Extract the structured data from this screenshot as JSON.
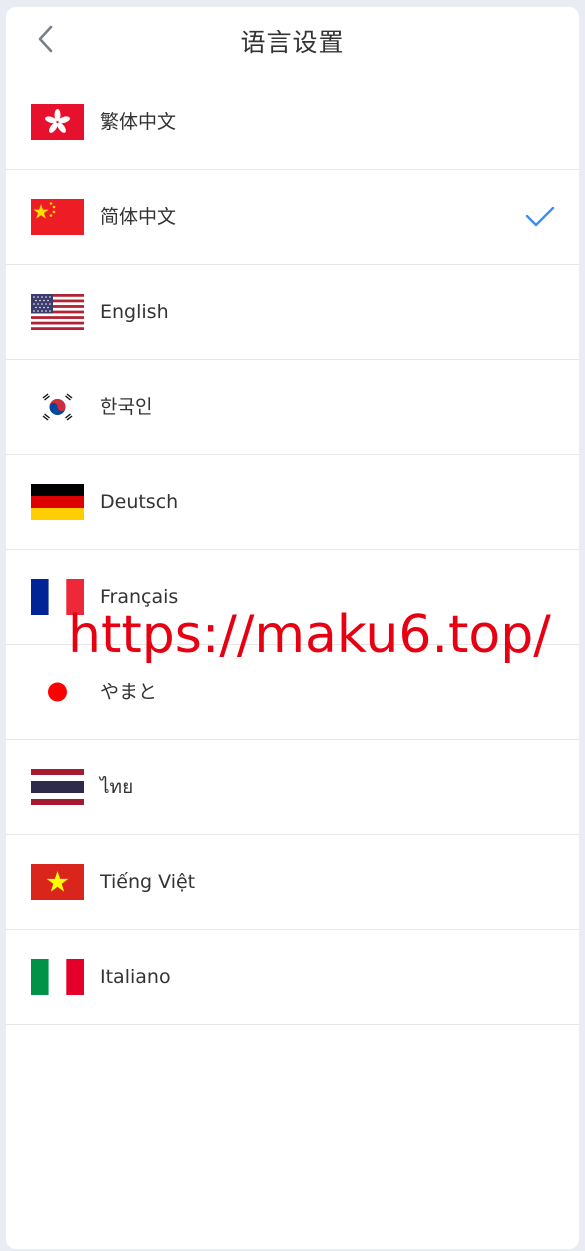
{
  "header": {
    "title": "语言设置"
  },
  "languages": [
    {
      "label": "繁体中文",
      "flag": "hk-flag-icon",
      "selected": false
    },
    {
      "label": "简体中文",
      "flag": "cn-flag-icon",
      "selected": true
    },
    {
      "label": "English",
      "flag": "us-flag-icon",
      "selected": false
    },
    {
      "label": "한국인",
      "flag": "kr-flag-icon",
      "selected": false
    },
    {
      "label": "Deutsch",
      "flag": "de-flag-icon",
      "selected": false
    },
    {
      "label": "Français",
      "flag": "fr-flag-icon",
      "selected": false
    },
    {
      "label": "やまと",
      "flag": "jp-flag-icon",
      "selected": false
    },
    {
      "label": "ไทย",
      "flag": "th-flag-icon",
      "selected": false
    },
    {
      "label": "Tiếng Việt",
      "flag": "vn-flag-icon",
      "selected": false
    },
    {
      "label": "Italiano",
      "flag": "it-flag-icon",
      "selected": false
    }
  ],
  "watermark": "https://maku6.top/",
  "colors": {
    "accent": "#3d8ef0",
    "watermark": "#e60012"
  }
}
